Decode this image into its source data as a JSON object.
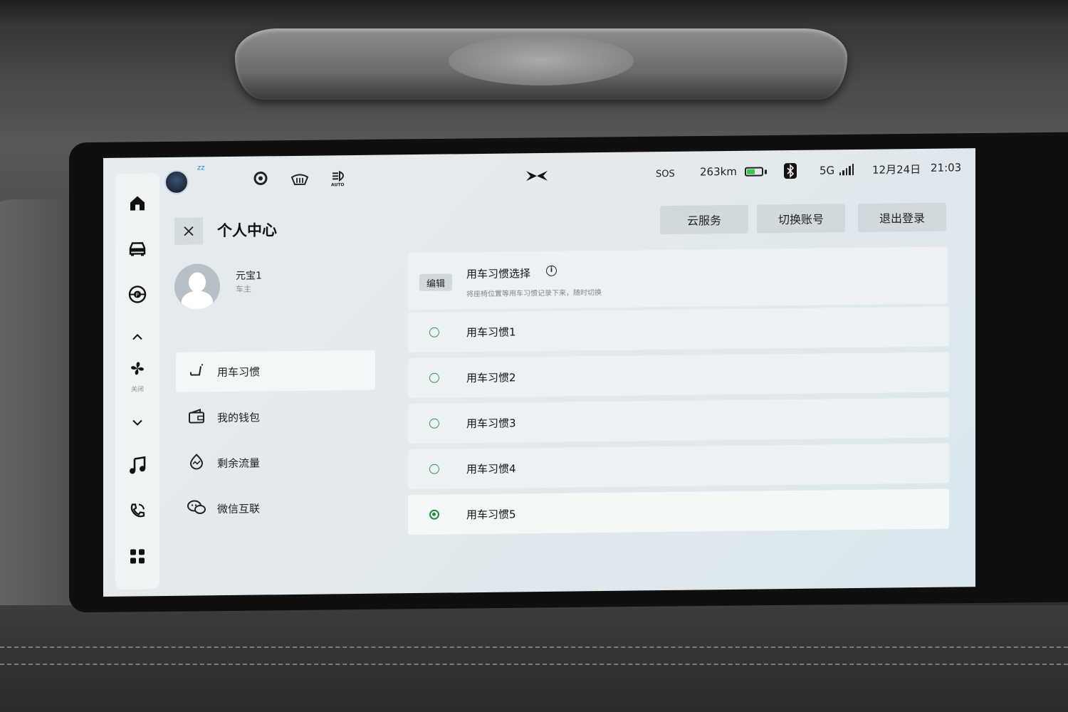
{
  "status_bar": {
    "sos": "SOS",
    "range": "263km",
    "battery_level": 0.55,
    "battery_color": "#35c84a",
    "network": "5G",
    "date": "12月24日",
    "time": "21:03",
    "icons": [
      "assistant-avatar-icon",
      "steering-heat-icon",
      "defrost-icon",
      "auto-headlight-icon",
      "brand-logo-icon",
      "bluetooth-icon",
      "signal-icon"
    ],
    "auto_label": "AUTO",
    "sleep_label": "zz"
  },
  "dock": {
    "items": [
      "home-icon",
      "car-icon",
      "parking-icon",
      "chevron-up-icon",
      "fan-icon",
      "chevron-down-icon",
      "music-icon",
      "phone-icon",
      "apps-icon"
    ],
    "fan_label": "关闭"
  },
  "header": {
    "title": "个人中心",
    "buttons": {
      "cloud": "云服务",
      "switch_account": "切换账号",
      "logout": "退出登录"
    }
  },
  "profile": {
    "name": "元宝1",
    "role": "车主"
  },
  "menu": {
    "items": [
      {
        "label": "用车习惯",
        "icon": "seat-icon",
        "active": true
      },
      {
        "label": "我的钱包",
        "icon": "wallet-icon",
        "active": false
      },
      {
        "label": "剩余流量",
        "icon": "data-usage-icon",
        "active": false
      },
      {
        "label": "微信互联",
        "icon": "wechat-icon",
        "active": false
      }
    ]
  },
  "habits": {
    "edit_label": "编辑",
    "title": "用车习惯选择",
    "description": "将座椅位置等用车习惯记录下来，随时切换",
    "accent": "#1e8c3e",
    "options": [
      {
        "label": "用车习惯1",
        "selected": false
      },
      {
        "label": "用车习惯2",
        "selected": false
      },
      {
        "label": "用车习惯3",
        "selected": false
      },
      {
        "label": "用车习惯4",
        "selected": false
      },
      {
        "label": "用车习惯5",
        "selected": true
      }
    ]
  }
}
